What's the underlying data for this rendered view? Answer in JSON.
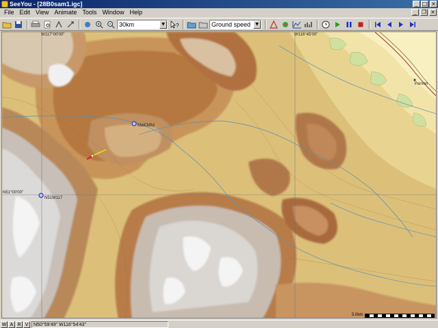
{
  "window": {
    "title": "SeeYou - [28B0sam1.igc]",
    "controls": {
      "minimize": "_",
      "maximize": "□",
      "close": "×"
    }
  },
  "menu": {
    "items": [
      "File",
      "Edit",
      "View",
      "Animate",
      "Tools",
      "Window",
      "Help"
    ],
    "mdi": {
      "minimize": "_",
      "restore": "❐",
      "close": "×"
    }
  },
  "toolbar": {
    "zoom_value": "30km",
    "graph_value": "Ground speed"
  },
  "map": {
    "grid_labels": {
      "lon_left": "W117°00'00\"",
      "lon_right": "W116°45'00\"",
      "lat": "N51°00'00\""
    },
    "waypoints": [
      {
        "name": "MalCkRd"
      },
      {
        "name": "N51W117"
      },
      {
        "name": "Parson"
      }
    ],
    "scale_label": "5.0km"
  },
  "status": {
    "buttons": [
      "W",
      "A",
      "R",
      "V"
    ],
    "coordinates": "N50°59'49\"  W116°54'43\""
  },
  "colors": {
    "titlebar": "#0a246a",
    "track_glider": "#e8e000",
    "track_tail": "#d02020",
    "waypoint": "#2030c0"
  }
}
